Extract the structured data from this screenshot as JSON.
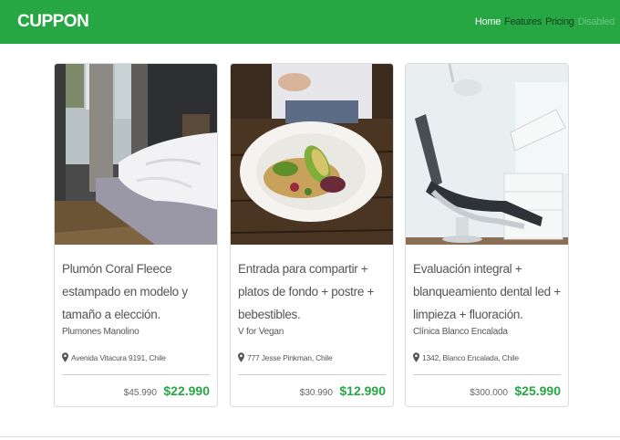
{
  "navbar": {
    "brand": "CUPPON",
    "links": [
      {
        "label": "Home",
        "state": "active"
      },
      {
        "label": "Features",
        "state": "link"
      },
      {
        "label": "Pricing",
        "state": "link"
      },
      {
        "label": "Disabled",
        "state": "disabled"
      }
    ]
  },
  "colors": {
    "primary": "#27a744",
    "text": "#555555"
  },
  "cards": [
    {
      "title": "Plumón Coral Fleece estampado en modelo y tamaño a elección.",
      "vendor": "Plumones Manolino",
      "address": "Avenida Vitacura 9191, Chile",
      "old_price": "$45.990",
      "new_price": "$22.990",
      "image": "bedroom-photo"
    },
    {
      "title": "Entrada para compartir + platos de fondo + postre + bebestibles.",
      "vendor": "V for Vegan",
      "address": "777 Jesse Pinkman, Chile",
      "old_price": "$30.990",
      "new_price": "$12.990",
      "image": "salad-photo"
    },
    {
      "title": "Evaluación integral + blanqueamiento dental led + limpieza + fluoración.",
      "vendor": "Clínica Blanco Encalada",
      "address": "1342, Blanco Encalada, Chile",
      "old_price": "$300.000",
      "new_price": "$25.990",
      "image": "dental-chair-photo"
    }
  ]
}
